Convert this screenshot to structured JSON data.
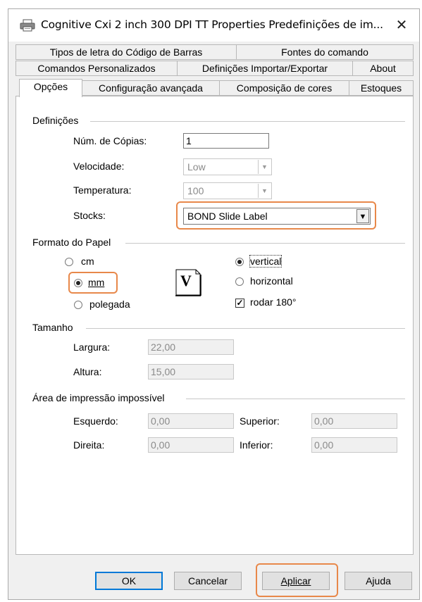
{
  "window": {
    "title": "Cognitive Cxi 2 inch 300 DPI TT Properties Predefinições de im...",
    "close_glyph": "✕"
  },
  "tabs": {
    "row1": [
      "Tipos de letra do Código de Barras",
      "Fontes do comando"
    ],
    "row2": [
      "Comandos Personalizados",
      "Definições Importar/Exportar",
      "About"
    ],
    "row3": [
      "Opções",
      "Configuração avançada",
      "Composição de cores",
      "Estoques"
    ],
    "active": "Opções"
  },
  "definicoes": {
    "title": "Definições",
    "copies_label": "Núm. de Cópias:",
    "copies_value": "1",
    "speed_label": "Velocidade:",
    "speed_value": "Low",
    "temperature_label": "Temperatura:",
    "temperature_value": "100",
    "stocks_label": "Stocks:",
    "stocks_value": "BOND Slide Label"
  },
  "formato": {
    "title": "Formato do Papel",
    "units": {
      "cm": "cm",
      "mm": "mm",
      "inch": "polegada",
      "selected": "mm"
    },
    "orientation": {
      "vertical": "vertical",
      "horizontal": "horizontal",
      "selected": "vertical",
      "icon_letter": "V"
    },
    "rotate_label": "rodar 180°",
    "rotate_checked": true
  },
  "tamanho": {
    "title": "Tamanho",
    "width_label": "Largura:",
    "width_value": "22,00",
    "height_label": "Altura:",
    "height_value": "15,00"
  },
  "area": {
    "title": "Área de impressão impossível",
    "left_label": "Esquerdo:",
    "left_value": "0,00",
    "top_label": "Superior:",
    "top_value": "0,00",
    "right_label": "Direita:",
    "right_value": "0,00",
    "bottom_label": "Inferior:",
    "bottom_value": "0,00"
  },
  "buttons": {
    "ok": "OK",
    "cancel": "Cancelar",
    "apply": "Aplicar",
    "help": "Ajuda"
  },
  "colors": {
    "highlight": "#e8884a",
    "default_button_border": "#0078d7"
  }
}
